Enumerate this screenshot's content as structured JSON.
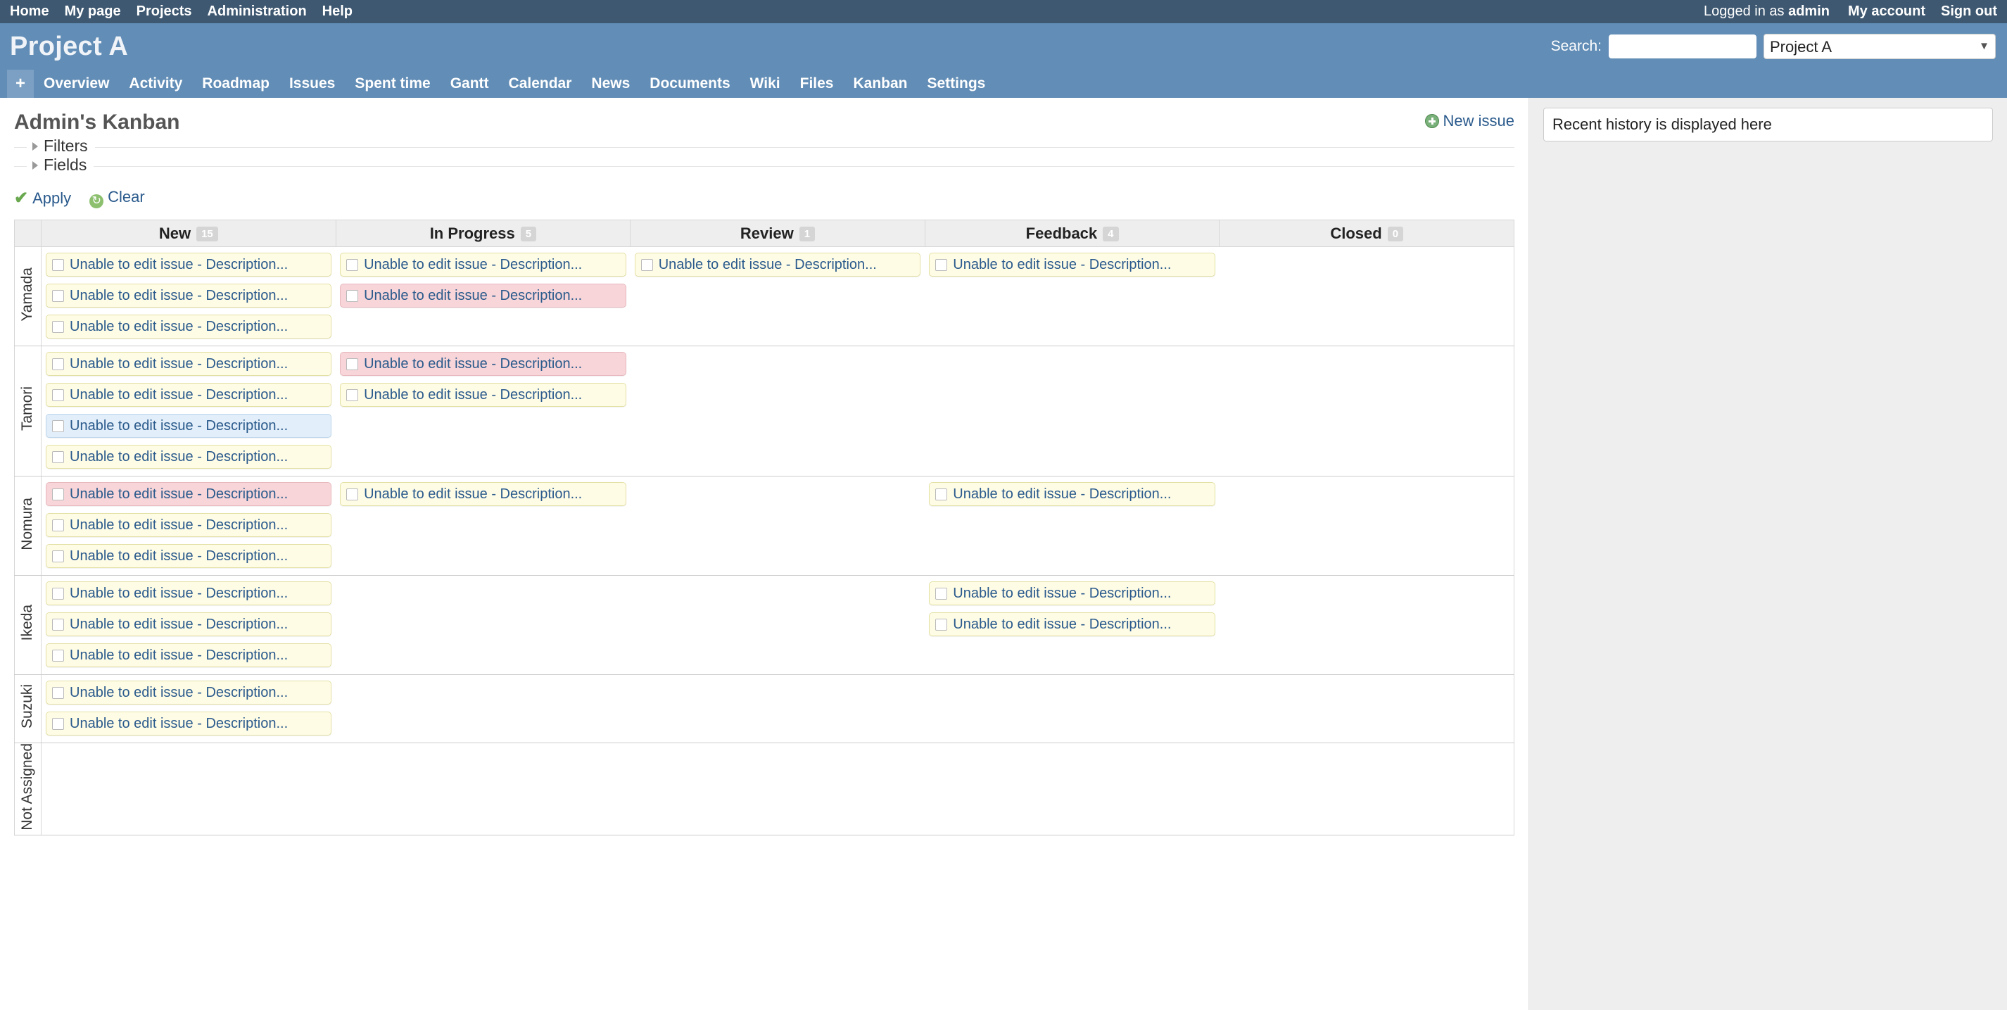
{
  "top_menu": {
    "left_items": [
      {
        "label": "Home",
        "name": "top-menu-home"
      },
      {
        "label": "My page",
        "name": "top-menu-my-page"
      },
      {
        "label": "Projects",
        "name": "top-menu-projects"
      },
      {
        "label": "Administration",
        "name": "top-menu-administration"
      },
      {
        "label": "Help",
        "name": "top-menu-help"
      }
    ],
    "logged_in_prefix": "Logged in as ",
    "logged_in_user": "admin",
    "my_account": "My account",
    "sign_out": "Sign out"
  },
  "header": {
    "project_title": "Project A",
    "search_label": "Search:",
    "search_value": "",
    "search_placeholder": "",
    "project_select_value": "Project A",
    "project_select_options": [
      "Project A"
    ]
  },
  "main_menu": {
    "add_label": "+",
    "items": [
      {
        "label": "Overview"
      },
      {
        "label": "Activity"
      },
      {
        "label": "Roadmap"
      },
      {
        "label": "Issues"
      },
      {
        "label": "Spent time"
      },
      {
        "label": "Gantt"
      },
      {
        "label": "Calendar"
      },
      {
        "label": "News"
      },
      {
        "label": "Documents"
      },
      {
        "label": "Wiki"
      },
      {
        "label": "Files"
      },
      {
        "label": "Kanban"
      },
      {
        "label": "Settings"
      }
    ]
  },
  "page": {
    "title": "Admin's Kanban",
    "new_issue_label": "New issue",
    "filters_legend": "Filters",
    "fields_legend": "Fields",
    "apply_label": "Apply",
    "clear_label": "Clear"
  },
  "sidebar": {
    "recent_history_text": "Recent history is displayed here"
  },
  "board": {
    "columns": [
      {
        "label": "New",
        "count": "15"
      },
      {
        "label": "In Progress",
        "count": "5"
      },
      {
        "label": "Review",
        "count": "1"
      },
      {
        "label": "Feedback",
        "count": "4"
      },
      {
        "label": "Closed",
        "count": "0"
      }
    ],
    "card_text": "Unable to edit issue - Description...",
    "swimlanes": [
      {
        "name": "Yamada",
        "cells": [
          [
            {
              "color": "yellow"
            },
            {
              "color": "yellow"
            },
            {
              "color": "yellow"
            }
          ],
          [
            {
              "color": "yellow"
            },
            {
              "color": "pink"
            }
          ],
          [
            {
              "color": "yellow"
            }
          ],
          [
            {
              "color": "yellow"
            }
          ],
          []
        ]
      },
      {
        "name": "Tamori",
        "cells": [
          [
            {
              "color": "yellow"
            },
            {
              "color": "yellow"
            },
            {
              "color": "blue"
            },
            {
              "color": "yellow"
            }
          ],
          [
            {
              "color": "pink"
            },
            {
              "color": "yellow"
            }
          ],
          [],
          [],
          []
        ]
      },
      {
        "name": "Nomura",
        "cells": [
          [
            {
              "color": "pink"
            },
            {
              "color": "yellow"
            },
            {
              "color": "yellow"
            }
          ],
          [
            {
              "color": "yellow"
            }
          ],
          [],
          [
            {
              "color": "yellow"
            }
          ],
          []
        ]
      },
      {
        "name": "Ikeda",
        "cells": [
          [
            {
              "color": "yellow"
            },
            {
              "color": "yellow"
            },
            {
              "color": "yellow"
            }
          ],
          [],
          [],
          [
            {
              "color": "yellow"
            },
            {
              "color": "yellow"
            }
          ],
          []
        ]
      },
      {
        "name": "Suzuki",
        "cells": [
          [
            {
              "color": "yellow"
            },
            {
              "color": "yellow"
            }
          ],
          [],
          [],
          [],
          []
        ]
      },
      {
        "name": "Not Assigned",
        "cells": [
          [],
          [],
          [],
          [],
          []
        ]
      }
    ]
  },
  "colors": {
    "top_bar": "#3e5871",
    "header": "#628db6",
    "link": "#2a5a8c",
    "sidebar_bg": "#eeeeee",
    "card_yellow": "#fffce6",
    "card_pink": "#f7d5d8",
    "card_blue": "#e2eef9"
  }
}
